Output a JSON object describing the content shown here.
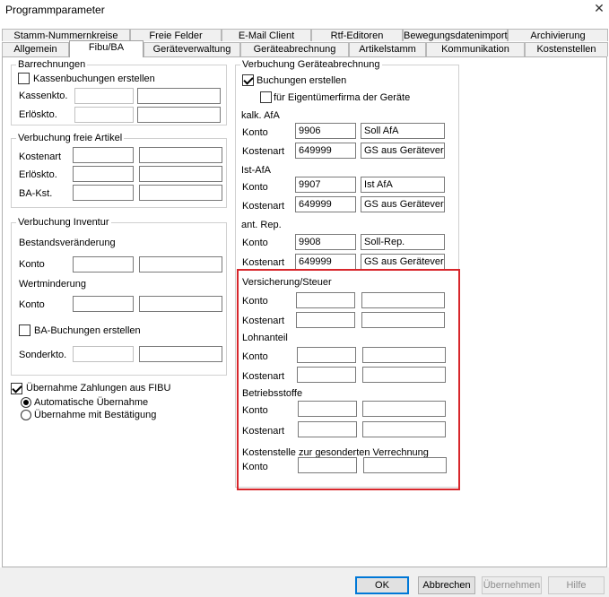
{
  "window": {
    "title": "Programmparameter"
  },
  "tabs_row1": [
    "Stamm-Nummernkreise",
    "Freie Felder",
    "E-Mail Client",
    "Rtf-Editoren",
    "Bewegungsdatenimport",
    "Archivierung"
  ],
  "tabs_row2": [
    "Allgemein",
    "Fibu/BA",
    "Geräteverwaltung",
    "Geräteabrechnung",
    "Artikelstamm",
    "Kommunikation",
    "Kostenstellen"
  ],
  "barrechnungen": {
    "legend": "Barrechnungen",
    "kassenbuchungen_label": "Kassenbuchungen erstellen",
    "kassenbuchungen_checked": false,
    "kassenkto_label": "Kassenkto.",
    "erloeskto_label": "Erlöskto.",
    "kassenkto_1": "",
    "kassenkto_2": "",
    "erloeskto_1": "",
    "erloeskto_2": ""
  },
  "freie_artikel": {
    "legend": "Verbuchung freie Artikel",
    "kostenart_label": "Kostenart",
    "erloeskto_label": "Erlöskto.",
    "bakst_label": "BA-Kst.",
    "values": [
      "",
      "",
      "",
      "",
      "",
      ""
    ]
  },
  "inventur": {
    "legend": "Verbuchung Inventur",
    "bestand_label": "Bestandsveränderung",
    "konto_label": "Konto",
    "wertminderung_label": "Wertminderung",
    "konto2_label": "Konto",
    "ba_buchungen_label": "BA-Buchungen erstellen",
    "ba_buchungen_checked": false,
    "sonderkto_label": "Sonderkto.",
    "values": [
      "",
      "",
      "",
      "",
      "",
      ""
    ]
  },
  "fibu": {
    "uebernahme_label": "Übernahme Zahlungen aus FIBU",
    "uebernahme_checked": true,
    "auto_label": "Automatische Übernahme",
    "bestaetigung_label": "Übernahme mit Bestätigung",
    "selected": "auto"
  },
  "geraete": {
    "legend": "Verbuchung Geräteabrechnung",
    "buchungen_label": "Buchungen erstellen",
    "buchungen_checked": true,
    "eigentuemer_label": "für Eigentümerfirma der Geräte",
    "eigentuemer_checked": false,
    "kalk_afa": {
      "title": "kalk. AfA",
      "konto_label": "Konto",
      "kostenart_label": "Kostenart",
      "konto_nr": "9906",
      "konto_name": "Soll AfA",
      "kostenart_nr": "649999",
      "kostenart_name": "GS aus Geräteverrec"
    },
    "ist_afa": {
      "title": "Ist-AfA",
      "konto_label": "Konto",
      "kostenart_label": "Kostenart",
      "konto_nr": "9907",
      "konto_name": "Ist AfA",
      "kostenart_nr": "649999",
      "kostenart_name": "GS aus Geräteverrec"
    },
    "ant_rep": {
      "title": "ant. Rep.",
      "konto_label": "Konto",
      "kostenart_label": "Kostenart",
      "konto_nr": "9908",
      "konto_name": "Soll-Rep.",
      "kostenart_nr": "649999",
      "kostenart_name": "GS aus Geräteverrec"
    },
    "versicherung": {
      "title": "Versicherung/Steuer",
      "konto_label": "Konto",
      "kostenart_label": "Kostenart"
    },
    "lohnanteil": {
      "title": "Lohnanteil",
      "konto_label": "Konto",
      "kostenart_label": "Kostenart"
    },
    "betriebsstoffe": {
      "title": "Betriebsstoffe",
      "konto_label": "Konto",
      "kostenart_label": "Kostenart"
    },
    "kostenstelle": {
      "title": "Kostenstelle zur gesonderten Verrechnung",
      "konto_label": "Konto"
    }
  },
  "buttons": {
    "ok": "OK",
    "abbrechen": "Abbrechen",
    "uebernehmen": "Übernehmen",
    "hilfe": "Hilfe"
  },
  "colors": {
    "highlight": "#d7262b",
    "default_button_border": "#0078d7"
  }
}
